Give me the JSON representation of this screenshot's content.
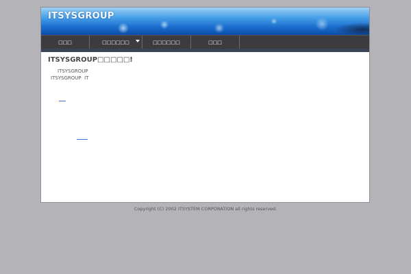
{
  "header": {
    "site_title": "ITSYSGROUP"
  },
  "nav": {
    "items": [
      {
        "label": "□□□"
      },
      {
        "label": "□□□□□□"
      },
      {
        "label": "□□□□□□"
      },
      {
        "label": "□□□"
      }
    ]
  },
  "content": {
    "title": "ITSYSGROUP□□□□□!",
    "lines": [
      "ITSYSGROUP",
      "ITSYSGROUP  IT"
    ]
  },
  "footer": {
    "copyright": "Copyright (C) 2002 ITSYSTEM CORPORATION all rights reserved."
  },
  "colors": {
    "page_bg": "#b3b3b8",
    "nav_bg": "#3c3c3f",
    "link": "#3a70c8"
  }
}
